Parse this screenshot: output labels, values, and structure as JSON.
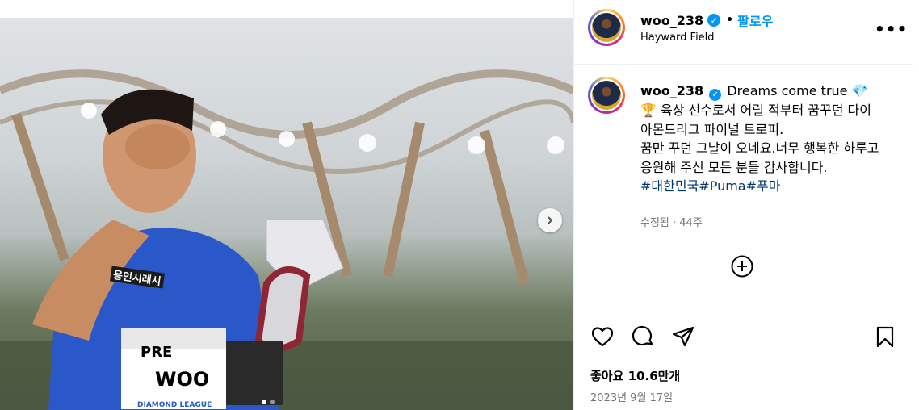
{
  "photo": {
    "bib_brand": "PRE",
    "bib_name": "WOO",
    "bib_sponsor": "DIAMOND LEAGUE",
    "shirt_text": "용인시레시",
    "dots_total": 2,
    "dots_active": 1
  },
  "header": {
    "username": "woo_238",
    "bullet": "•",
    "follow_label": "팔로우",
    "location": "Hayward Field",
    "more_label": "•••"
  },
  "caption": {
    "username": "woo_238",
    "title": "Dreams come true",
    "gem": "💎",
    "trophy": "🏆",
    "line1": "육상 선수로서 어릴 적부터 꿈꾸던 다이아몬드리그 파이널 트로피.",
    "line2": "꿈만 꾸던 그날이 오네요.너무 행복한 하루고 응원해 주신 모든 분들 감사합니다.",
    "hashtags": [
      "#대한민국",
      "#Puma",
      "#푸마"
    ],
    "meta": "수정됨 · 44주"
  },
  "footer": {
    "likes": "좋아요 10.6만개",
    "date": "2023년 9월 17일"
  },
  "icons": {
    "verified": "verified-badge-icon",
    "next": "chevron-right-icon",
    "add": "add-circle-icon",
    "like": "heart-icon",
    "comment": "comment-icon",
    "share": "send-icon",
    "save": "bookmark-icon"
  },
  "colors": {
    "accent": "#0095f6",
    "hashtag": "#00376b",
    "muted": "#737373"
  }
}
